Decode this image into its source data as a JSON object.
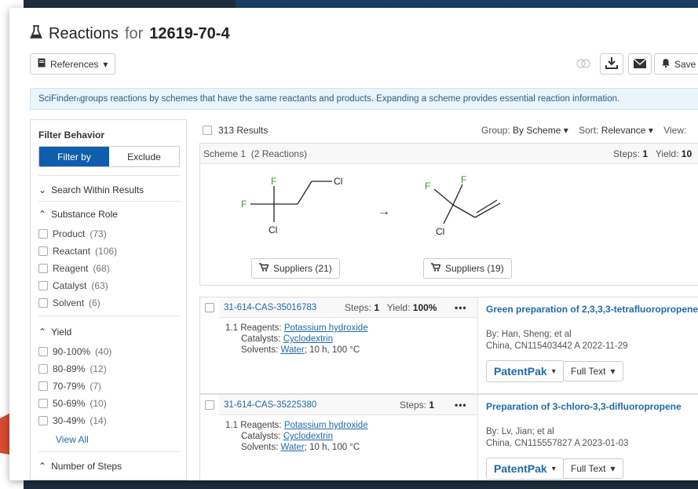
{
  "header": {
    "title_prefix": "Reactions",
    "title_for": "for",
    "cas": "12619-70-4"
  },
  "toolbar": {
    "references_label": "References",
    "save_label": "Save"
  },
  "info_bar": {
    "text_brand": "SciFinder",
    "text_sup": "n",
    "text": " groups reactions by schemes that have the same reactants and products. Expanding a scheme provides essential reaction information."
  },
  "sidebar": {
    "title": "Filter Behavior",
    "filter_by": "Filter by",
    "exclude": "Exclude",
    "search_within": "Search Within Results",
    "substance_role": {
      "title": "Substance Role",
      "items": [
        {
          "label": "Product",
          "count": "(73)"
        },
        {
          "label": "Reactant",
          "count": "(106)"
        },
        {
          "label": "Reagent",
          "count": "(68)"
        },
        {
          "label": "Catalyst",
          "count": "(63)"
        },
        {
          "label": "Solvent",
          "count": "(6)"
        }
      ]
    },
    "yield": {
      "title": "Yield",
      "items": [
        {
          "label": "90-100%",
          "count": "(40)"
        },
        {
          "label": "80-89%",
          "count": "(12)"
        },
        {
          "label": "70-79%",
          "count": "(7)"
        },
        {
          "label": "50-69%",
          "count": "(10)"
        },
        {
          "label": "30-49%",
          "count": "(14)"
        }
      ],
      "view_all": "View All"
    },
    "steps": {
      "title": "Number of Steps"
    }
  },
  "results": {
    "count": "313 Results",
    "group_label": "Group:",
    "group_value": "By Scheme",
    "sort_label": "Sort:",
    "sort_value": "Relevance",
    "view_label": "View:"
  },
  "scheme": {
    "title": "Scheme 1",
    "reactions": "(2 Reactions)",
    "steps_label": "Steps:",
    "steps_value": "1",
    "yield_label": "Yield:",
    "yield_value": "10",
    "reactant_suppliers": "Suppliers (21)",
    "product_suppliers": "Suppliers (19)",
    "atoms": {
      "F": "F",
      "Cl": "Cl"
    },
    "arrow": "→"
  },
  "reactions": [
    {
      "id": "31-614-CAS-35016783",
      "steps_label": "Steps:",
      "steps": "1",
      "yield_label": "Yield:",
      "yield": "100%",
      "step_no": "1.1",
      "reagents_label": "Reagents:",
      "reagents": "Potassium hydroxide",
      "catalysts_label": "Catalysts:",
      "catalysts": "Cyclodextrin",
      "solvents_label": "Solvents:",
      "solvents": "Water",
      "conditions": "; 10 h, 100 °C",
      "title": "Green preparation of 2,3,3,3-tetrafluoropropene",
      "by": "By: Han, Sheng; et al",
      "source": "China, CN115403442 A 2022-11-29",
      "patentpak": "PatentPak",
      "fulltext": "Full Text"
    },
    {
      "id": "31-614-CAS-35225380",
      "steps_label": "Steps:",
      "steps": "1",
      "step_no": "1.1",
      "reagents_label": "Reagents:",
      "reagents": "Potassium hydroxide",
      "catalysts_label": "Catalysts:",
      "catalysts": "Cyclodextrin",
      "solvents_label": "Solvents:",
      "solvents": "Water",
      "conditions": "; 10 h, 100 °C",
      "title": "Preparation of 3-chloro-3,3-difluoropropene",
      "by": "By: Lv, Jian; et al",
      "source": "China, CN115557827 A 2023-01-03",
      "patentpak": "PatentPak",
      "fulltext": "Full Text"
    }
  ],
  "colors": {
    "primary": "#0f5eae",
    "link": "#1f6aa8",
    "fluorine": "#2ca02c"
  }
}
